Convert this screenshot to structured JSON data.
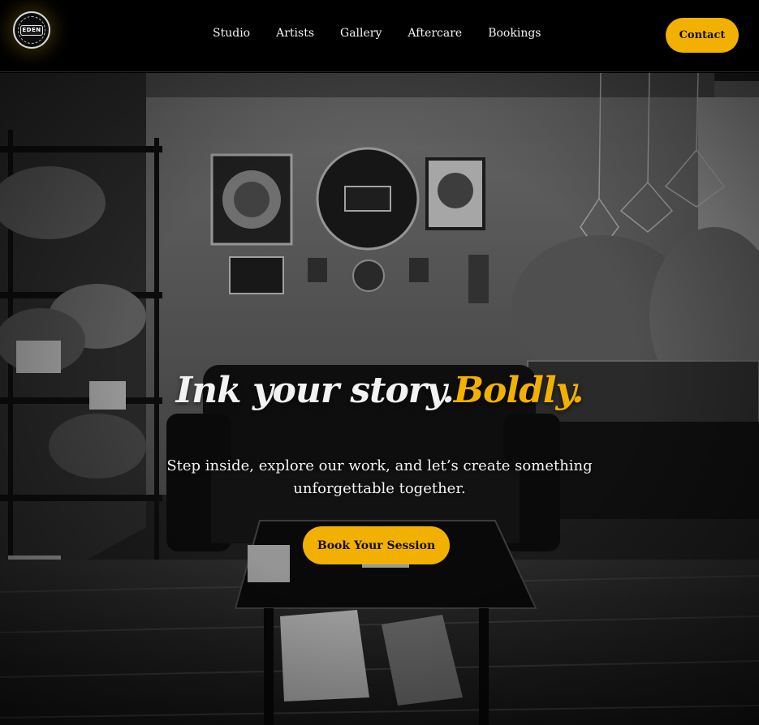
{
  "brand": {
    "logo_text": "EDEN",
    "accent_color": "#f2b100"
  },
  "nav": {
    "items": [
      {
        "label": "Studio"
      },
      {
        "label": "Artists"
      },
      {
        "label": "Gallery"
      },
      {
        "label": "Aftercare"
      },
      {
        "label": "Bookings"
      }
    ],
    "contact_label": "Contact"
  },
  "hero": {
    "headline_main": "Ink your story.",
    "headline_accent": "Boldly.",
    "subtext": "Step inside, explore our work, and let’s create something unforgettable together.",
    "cta_label": "Book Your Session"
  }
}
